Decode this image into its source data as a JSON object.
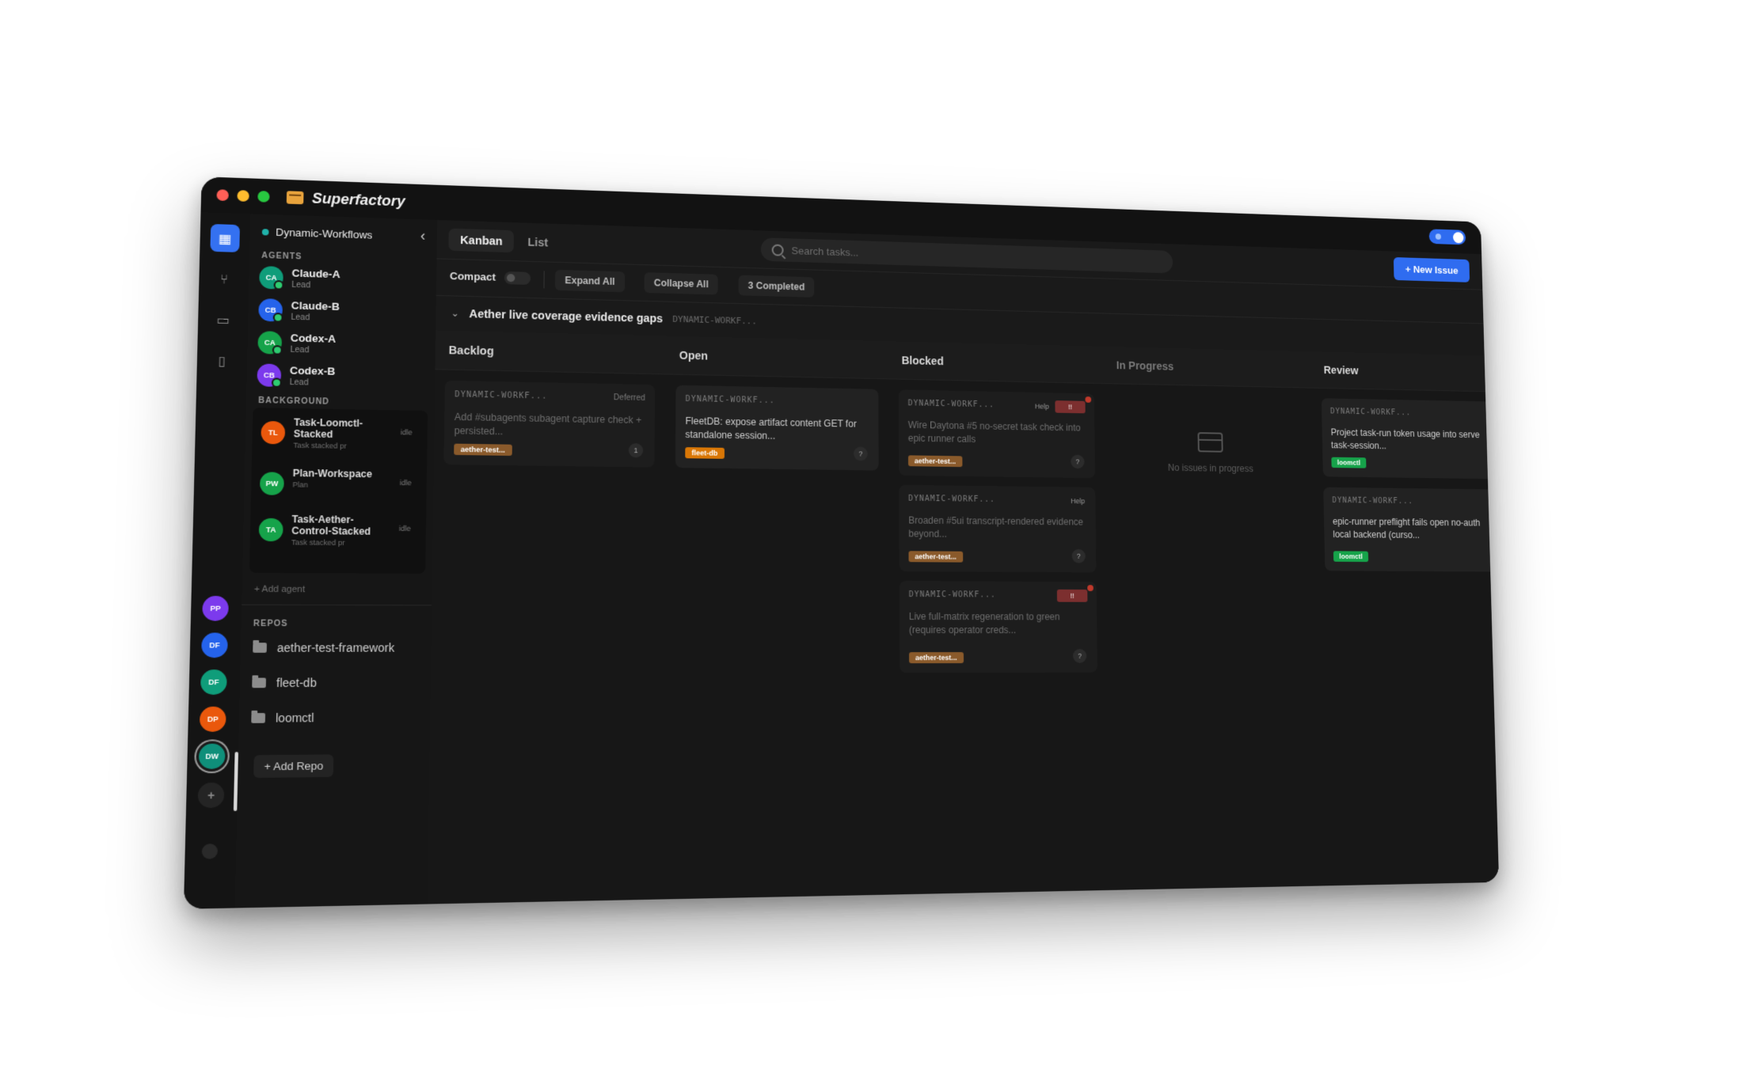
{
  "app": {
    "title": "Superfactory"
  },
  "rail": {
    "workspaces": [
      {
        "initials": "PP",
        "color": "#7c3aed"
      },
      {
        "initials": "DF",
        "color": "#2563eb"
      },
      {
        "initials": "DF",
        "color": "#0f9d7a"
      },
      {
        "initials": "DP",
        "color": "#ea580c"
      },
      {
        "initials": "DW",
        "color": "#0f8f7a"
      }
    ],
    "add_label": "+"
  },
  "sidebar": {
    "project": "Dynamic-Workflows",
    "agents_label": "AGENTS",
    "agents": [
      {
        "initials": "CA",
        "name": "Claude-A",
        "role": "Lead",
        "color": "#0f9d7a"
      },
      {
        "initials": "CB",
        "name": "Claude-B",
        "role": "Lead",
        "color": "#2563eb"
      },
      {
        "initials": "CA",
        "name": "Codex-A",
        "role": "Lead",
        "color": "#16a34a"
      },
      {
        "initials": "CB",
        "name": "Codex-B",
        "role": "Lead",
        "color": "#7c3aed"
      }
    ],
    "background_label": "BACKGROUND",
    "background": [
      {
        "initials": "TL",
        "name": "Task-Loomctl-Stacked",
        "sub": "Task stacked pr",
        "status": "idle",
        "color": "#ea580c"
      },
      {
        "initials": "PW",
        "name": "Plan-Workspace",
        "sub": "Plan",
        "status": "idle",
        "color": "#16a34a"
      },
      {
        "initials": "TA",
        "name": "Task-Aether-Control-Stacked",
        "sub": "Task stacked pr",
        "status": "idle",
        "color": "#16a34a"
      }
    ],
    "add_agent": "+ Add agent",
    "repos_label": "REPOS",
    "repos": [
      "aether-test-framework",
      "fleet-db",
      "loomctl"
    ],
    "add_repo": "+ Add Repo"
  },
  "topbar": {
    "tabs": [
      "Kanban",
      "List"
    ],
    "search_placeholder": "Search tasks...",
    "new_issue": "+ New Issue"
  },
  "toolbar": {
    "compact": "Compact",
    "expand_all": "Expand All",
    "collapse_all": "Collapse All",
    "completed": "3 Completed"
  },
  "group": {
    "title": "Aether live coverage evidence gaps",
    "code": "DYNAMIC-WORKF..."
  },
  "columns": {
    "backlog": {
      "title": "Backlog",
      "cards": [
        {
          "code": "DYNAMIC-WORKF...",
          "meta": "Deferred",
          "title": "Add #subagents subagent capture check + persisted...",
          "tag": "aether-test...",
          "tag_color": "#8a5a2b",
          "count": "1"
        }
      ]
    },
    "open": {
      "title": "Open",
      "cards": [
        {
          "code": "DYNAMIC-WORKF...",
          "title": "FleetDB: expose artifact content GET for standalone session...",
          "tag": "fleet-db",
          "tag_color": "#d97706",
          "count": "?"
        }
      ]
    },
    "blocked": {
      "title": "Blocked",
      "cards": [
        {
          "code": "DYNAMIC-WORKF...",
          "help": "Help",
          "priority": "!!",
          "title": "Wire Daytona #5 no-secret task check into epic runner calls",
          "tag": "aether-test...",
          "tag_color": "#8a5a2b",
          "count": "?"
        },
        {
          "code": "DYNAMIC-WORKF...",
          "help": "Help",
          "title": "Broaden #5ui transcript-rendered evidence beyond...",
          "tag": "aether-test...",
          "tag_color": "#8a5a2b",
          "count": "?"
        },
        {
          "code": "DYNAMIC-WORKF...",
          "priority": "!!",
          "title": "Live full-matrix regeneration to green (requires operator creds...",
          "tag": "aether-test...",
          "tag_color": "#8a5a2b",
          "count": "?"
        }
      ]
    },
    "in_progress": {
      "title": "In Progress",
      "empty": "No issues in progress"
    },
    "review": {
      "title": "Review",
      "cards": [
        {
          "code": "DYNAMIC-WORKF...",
          "title": "Project task-run token usage into serve task-session...",
          "tag": "loomctl",
          "tag_color": "#16a34a"
        },
        {
          "code": "DYNAMIC-WORKF...",
          "title": "epic-runner preflight fails open no-auth local backend (curso...",
          "tag": "loomctl",
          "tag_color": "#16a34a"
        }
      ]
    }
  }
}
